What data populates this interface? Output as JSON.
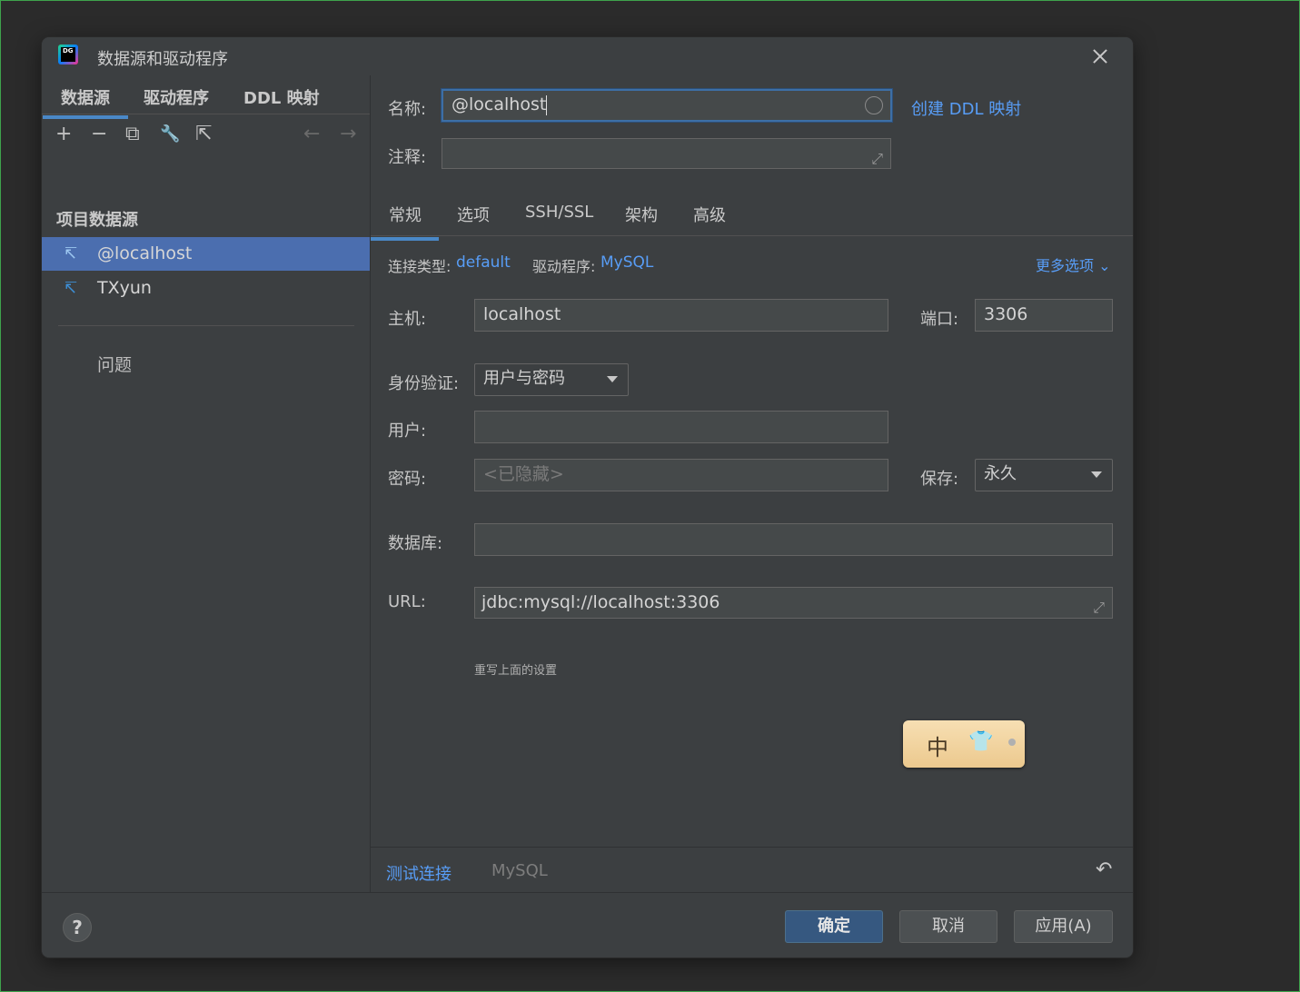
{
  "window": {
    "title": "数据源和驱动程序",
    "logo_text": "DG"
  },
  "left": {
    "tabs": [
      "数据源",
      "驱动程序",
      "DDL 映射"
    ],
    "toolbar": {
      "add": "+",
      "remove": "−",
      "copy": "⧉",
      "settings": "🔧",
      "export": "⇱",
      "back": "←",
      "forward": "→"
    },
    "section_title": "项目数据源",
    "datasources": [
      {
        "label": "@localhost",
        "icon": "mysql-dolphin-icon",
        "selected": true
      },
      {
        "label": "TXyun",
        "icon": "mysql-dolphin-icon",
        "selected": false
      }
    ],
    "issues_label": "问题"
  },
  "right": {
    "name_label": "名称:",
    "name_value": "@localhost",
    "create_ddl_link": "创建 DDL 映射",
    "comment_label": "注释:",
    "comment_value": "",
    "tabs": [
      "常规",
      "选项",
      "SSH/SSL",
      "架构",
      "高级"
    ],
    "conn_type_label": "连接类型:",
    "conn_type_value": "default",
    "driver_label": "驱动程序:",
    "driver_value": "MySQL",
    "more_options": "更多选项",
    "host_label": "主机:",
    "host_value": "localhost",
    "port_label": "端口:",
    "port_value": "3306",
    "auth_label": "身份验证:",
    "auth_value": "用户与密码",
    "user_label": "用户:",
    "user_value": "",
    "password_label": "密码:",
    "password_placeholder": "<已隐藏>",
    "save_label": "保存:",
    "save_value": "永久",
    "database_label": "数据库:",
    "database_value": "",
    "url_label": "URL:",
    "url_value": "jdbc:mysql://localhost:3306",
    "url_hint": "重写上面的设置",
    "ime": {
      "mode": "中"
    },
    "test_connection": "测试连接",
    "driver_footer": "MySQL"
  },
  "footer": {
    "help": "?",
    "ok": "确定",
    "cancel": "取消",
    "apply": "应用(A)"
  },
  "colors": {
    "accent": "#4a88c7",
    "link": "#589df6",
    "selection": "#4b6eaf",
    "primary_button": "#365880"
  }
}
